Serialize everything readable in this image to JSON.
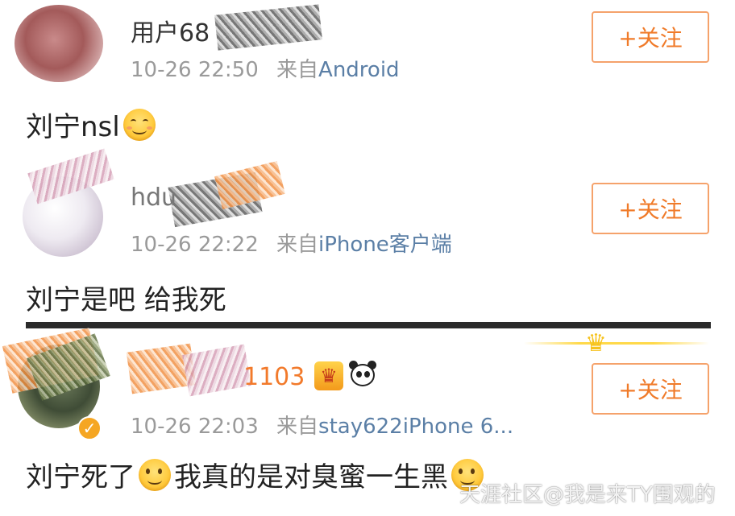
{
  "comments": [
    {
      "username": "用户68",
      "time": "10-26 22:50",
      "source_prefix": "来自",
      "source": "Android",
      "follow_label": "+关注",
      "text": "刘宁nsl",
      "emoji": "smiling-blush-emoji"
    },
    {
      "username": "hdu",
      "time": "10-26 22:22",
      "source_prefix": "来自",
      "source": "iPhone客户端",
      "follow_label": "+关注",
      "text": "刘宁是吧 给我死"
    },
    {
      "username_tail": "1103",
      "time": "10-26 22:03",
      "source_prefix": "来自",
      "source": "stay622iPhone 6...",
      "follow_label": "+关注",
      "text_part1": "刘宁死了",
      "text_part2": "我真的是对臭蜜一生黑",
      "emoji": "smile-emoji",
      "badges": [
        "crown-vip-icon",
        "panda-icon",
        "verified-icon"
      ]
    }
  ],
  "watermark": "天涯社区@我是来TY围观的",
  "colors": {
    "accent_orange": "#f07b2a",
    "source_blue": "#5b7fa6",
    "meta_gray": "#9a9a9a"
  }
}
